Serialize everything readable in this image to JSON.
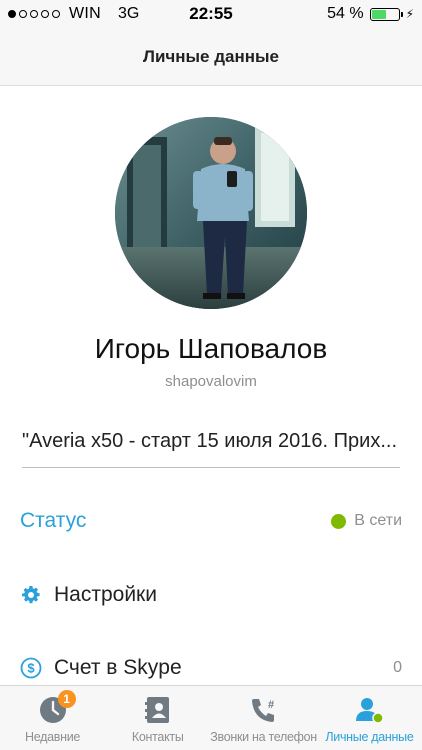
{
  "status_bar": {
    "carrier": "WIN",
    "network": "3G",
    "time": "22:55",
    "battery_text": "54 %",
    "battery_level": 0.54,
    "signal_strength": 1
  },
  "header": {
    "title": "Личные данные"
  },
  "profile": {
    "name": "Игорь Шаповалов",
    "username": "shapovalovim",
    "mood": "\"Averia x50 - старт 15 июля 2016. Прих..."
  },
  "rows": {
    "status_label": "Статус",
    "status_value": "В сети",
    "settings_label": "Настройки",
    "credit_label": "Счет в Skype",
    "credit_value": "0"
  },
  "tabs": {
    "recent": "Недавние",
    "recent_badge": "1",
    "contacts": "Контакты",
    "phone_calls": "Звонки на телефон",
    "profile": "Личные данные"
  },
  "colors": {
    "accent": "#2aa1da",
    "online": "#7fba00",
    "badge": "#f7931e",
    "battery": "#4cd964"
  }
}
